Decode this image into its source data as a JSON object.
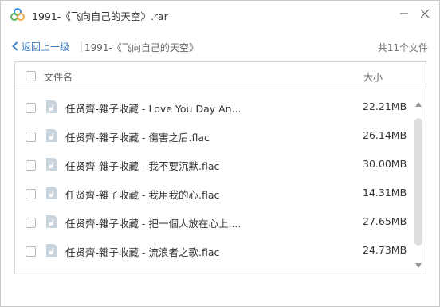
{
  "window": {
    "title": "1991-《飞向自己的天空》.rar",
    "accent_color": "#3b7fc6"
  },
  "nav": {
    "back_label": "返回上一级",
    "separator": "|",
    "path": "1991-《飞向自己的天空》",
    "file_count": "共11个文件"
  },
  "list": {
    "header_name": "文件名",
    "header_size": "大小",
    "files": [
      {
        "name": "任贤齊-雜子收藏 - Love You Day An...",
        "size": "22.21MB",
        "icon": "audio-file-icon"
      },
      {
        "name": "任贤齊-雜子收藏 - 傷害之后.flac",
        "size": "26.14MB",
        "icon": "audio-file-icon"
      },
      {
        "name": "任贤齊-雜子收藏 - 我不要沉默.flac",
        "size": "30.00MB",
        "icon": "audio-file-icon"
      },
      {
        "name": "任贤齊-雜子收藏 - 我用我的心.flac",
        "size": "14.31MB",
        "icon": "audio-file-icon"
      },
      {
        "name": "任贤齊-雜子收藏 - 把一個人放在心上....",
        "size": "27.65MB",
        "icon": "audio-file-icon"
      },
      {
        "name": "任贤齊-雜子收藏 - 流浪者之歌.flac",
        "size": "24.73MB",
        "icon": "audio-file-icon"
      }
    ]
  }
}
